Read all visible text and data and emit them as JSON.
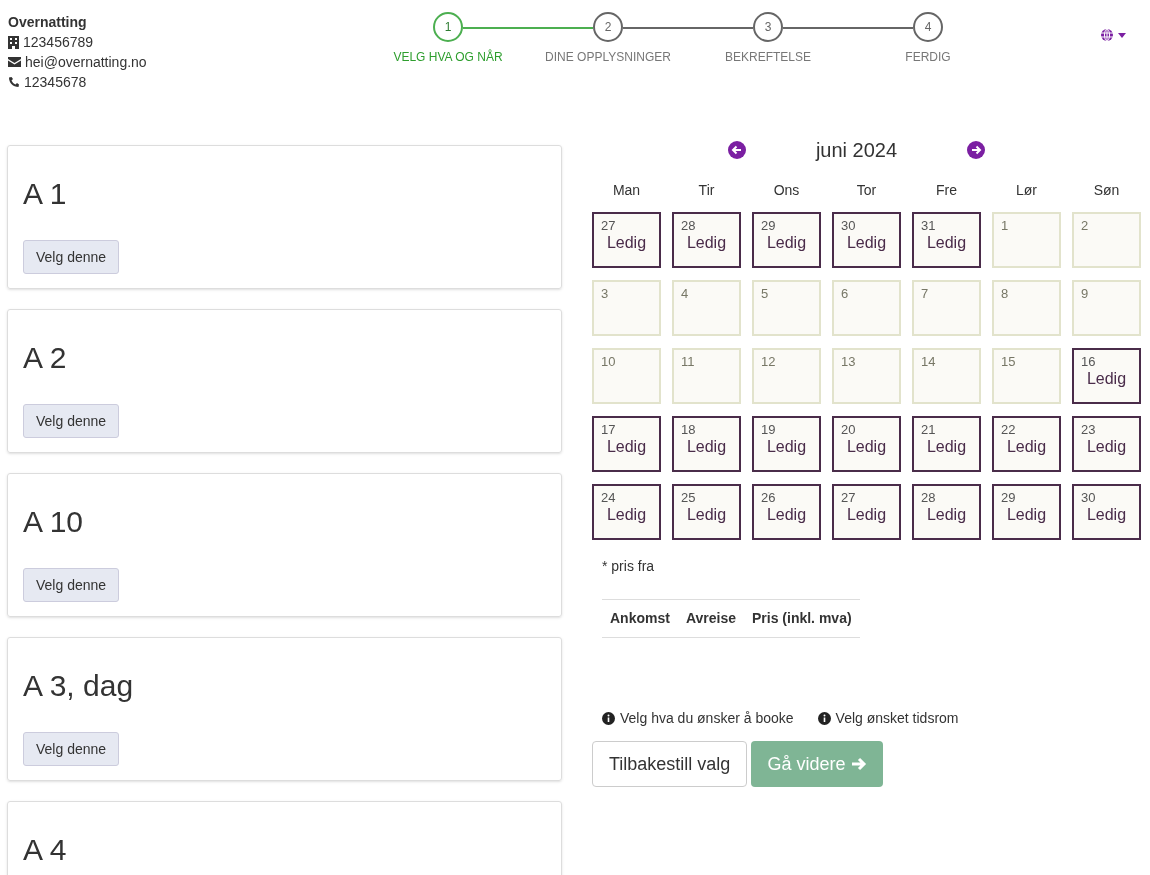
{
  "contact": {
    "name": "Overnatting",
    "org_number": "123456789",
    "email": "hei@overnatting.no",
    "phone": "12345678"
  },
  "steps": [
    {
      "number": "1",
      "label": "VELG HVA OG NÅR",
      "selected": true
    },
    {
      "number": "2",
      "label": "DINE OPPLYSNINGER",
      "selected": false
    },
    {
      "number": "3",
      "label": "BEKREFTELSE",
      "selected": false
    },
    {
      "number": "4",
      "label": "FERDIG",
      "selected": false
    }
  ],
  "units": [
    {
      "title": "A 1",
      "button": "Velg denne"
    },
    {
      "title": "A 2",
      "button": "Velg denne"
    },
    {
      "title": "A 10",
      "button": "Velg denne"
    },
    {
      "title": "A 3, dag",
      "button": "Velg denne"
    },
    {
      "title": "A 4"
    }
  ],
  "calendar": {
    "month": "juni 2024",
    "weekdays": [
      "Man",
      "Tir",
      "Ons",
      "Tor",
      "Fre",
      "Lør",
      "Søn"
    ],
    "days": [
      {
        "day": "27",
        "available": true,
        "status": "Ledig"
      },
      {
        "day": "28",
        "available": true,
        "status": "Ledig"
      },
      {
        "day": "29",
        "available": true,
        "status": "Ledig"
      },
      {
        "day": "30",
        "available": true,
        "status": "Ledig"
      },
      {
        "day": "31",
        "available": true,
        "status": "Ledig"
      },
      {
        "day": "1",
        "available": false
      },
      {
        "day": "2",
        "available": false
      },
      {
        "day": "3",
        "available": false
      },
      {
        "day": "4",
        "available": false
      },
      {
        "day": "5",
        "available": false
      },
      {
        "day": "6",
        "available": false
      },
      {
        "day": "7",
        "available": false
      },
      {
        "day": "8",
        "available": false
      },
      {
        "day": "9",
        "available": false
      },
      {
        "day": "10",
        "available": false
      },
      {
        "day": "11",
        "available": false
      },
      {
        "day": "12",
        "available": false
      },
      {
        "day": "13",
        "available": false
      },
      {
        "day": "14",
        "available": false
      },
      {
        "day": "15",
        "available": false
      },
      {
        "day": "16",
        "available": true,
        "status": "Ledig"
      },
      {
        "day": "17",
        "available": true,
        "status": "Ledig"
      },
      {
        "day": "18",
        "available": true,
        "status": "Ledig"
      },
      {
        "day": "19",
        "available": true,
        "status": "Ledig"
      },
      {
        "day": "20",
        "available": true,
        "status": "Ledig"
      },
      {
        "day": "21",
        "available": true,
        "status": "Ledig"
      },
      {
        "day": "22",
        "available": true,
        "status": "Ledig"
      },
      {
        "day": "23",
        "available": true,
        "status": "Ledig"
      },
      {
        "day": "24",
        "available": true,
        "status": "Ledig"
      },
      {
        "day": "25",
        "available": true,
        "status": "Ledig"
      },
      {
        "day": "26",
        "available": true,
        "status": "Ledig"
      },
      {
        "day": "27",
        "available": true,
        "status": "Ledig"
      },
      {
        "day": "28",
        "available": true,
        "status": "Ledig"
      },
      {
        "day": "29",
        "available": true,
        "status": "Ledig"
      },
      {
        "day": "30",
        "available": true,
        "status": "Ledig"
      }
    ],
    "note": "* pris fra"
  },
  "price_table": {
    "columns": [
      "Ankomst",
      "Avreise",
      "Pris (inkl. mva)"
    ]
  },
  "hints": [
    "Velg hva du ønsker å booke",
    "Velg ønsket tidsrom"
  ],
  "buttons": [
    {
      "kind": "reset",
      "label": "Tilbakestill valg"
    },
    {
      "kind": "next",
      "label": "Gå videre",
      "disabled": true
    }
  ]
}
